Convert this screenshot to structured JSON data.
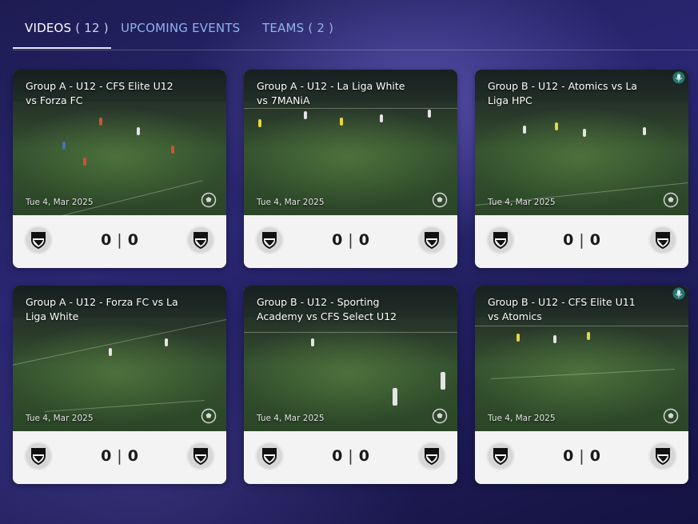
{
  "tabs": [
    {
      "label": "VIDEOS",
      "count": "( 12 )",
      "active": true
    },
    {
      "label": "UPCOMING EVENTS",
      "count": "",
      "active": false
    },
    {
      "label": "TEAMS",
      "count": "( 2 )",
      "active": false
    }
  ],
  "videos": [
    {
      "title": "Group A - U12 - CFS Elite U12 vs Forza FC",
      "date": "Tue 4, Mar 2025",
      "home_score": "0",
      "away_score": "0",
      "separator": "|",
      "mic": false
    },
    {
      "title": "Group A - U12 - La Liga White vs 7MANiA",
      "date": "Tue 4, Mar 2025",
      "home_score": "0",
      "away_score": "0",
      "separator": "|",
      "mic": false
    },
    {
      "title": "Group B - U12 - Atomics vs La Liga HPC",
      "date": "Tue 4, Mar 2025",
      "home_score": "0",
      "away_score": "0",
      "separator": "|",
      "mic": true
    },
    {
      "title": "Group A - U12 - Forza FC vs La Liga White",
      "date": "Tue 4, Mar 2025",
      "home_score": "0",
      "away_score": "0",
      "separator": "|",
      "mic": false
    },
    {
      "title": "Group B - U12 - Sporting Academy vs CFS Select U12",
      "date": "Tue 4, Mar 2025",
      "home_score": "0",
      "away_score": "0",
      "separator": "|",
      "mic": false
    },
    {
      "title": "Group B - U12 - CFS Elite U11 vs Atomics",
      "date": "Tue 4, Mar 2025",
      "home_score": "0",
      "away_score": "0",
      "separator": "|",
      "mic": true
    }
  ],
  "icons": {
    "ball": "soccer-ball-icon",
    "crest": "team-crest-icon",
    "mic": "microphone-icon"
  },
  "colors": {
    "active_tab": "#ffffff",
    "inactive_tab": "#8fb3ea",
    "card_bg": "#f3f3f3",
    "mic_badge": "#2fa39a"
  }
}
